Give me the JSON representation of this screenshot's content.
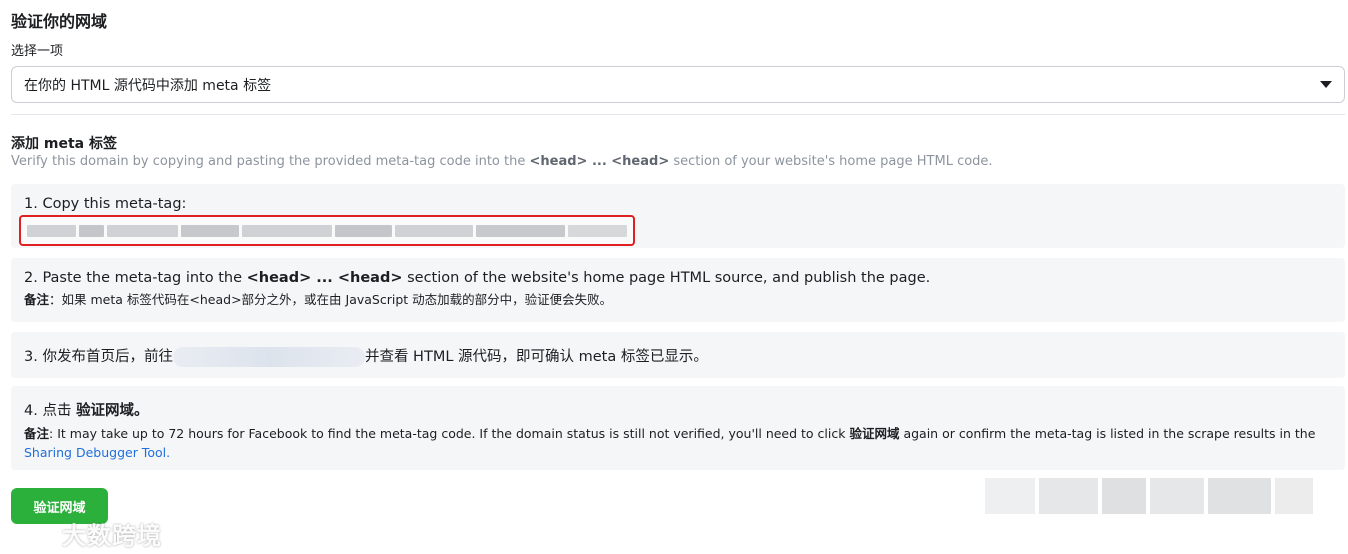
{
  "title": "验证你的网域",
  "select": {
    "label": "选择一项",
    "value": "在你的 HTML 源代码中添加 meta 标签"
  },
  "section": {
    "title": "添加 meta 标签",
    "desc_prefix": "Verify this domain by copying and pasting the provided meta-tag code into the ",
    "desc_tag": "<head> ... <head>",
    "desc_suffix": " section of your website's home page HTML code."
  },
  "steps": {
    "step1": {
      "text": "1. Copy this meta-tag:"
    },
    "step2": {
      "prefix": "2. Paste the meta-tag into the ",
      "tag": "<head> ... <head>",
      "suffix": " section of the website's home page HTML source, and publish the page.",
      "note_label": "备注",
      "note": "：如果 meta 标签代码在<head>部分之外，或在由 JavaScript 动态加载的部分中，验证便会失败。"
    },
    "step3": {
      "prefix": "3. 你发布首页后，前往",
      "suffix": "并查看 HTML 源代码，即可确认 meta 标签已显示。"
    },
    "step4": {
      "prefix": "4. 点击 ",
      "action": "验证网域。",
      "note_label": "备注",
      "note_text1": ": It may take up to 72 hours for Facebook to find the meta-tag code. If the domain status is still not verified, you'll need to click ",
      "note_bold": "验证网域",
      "note_text2": " again or confirm the meta-tag is listed in the scrape results in the",
      "link": "Sharing Debugger Tool."
    }
  },
  "verify_button": "验证网域",
  "watermark": "大数跨境",
  "colors": {
    "accent_green": "#2bb03b",
    "link_blue": "#216fdb",
    "highlight_red": "#e02020"
  }
}
